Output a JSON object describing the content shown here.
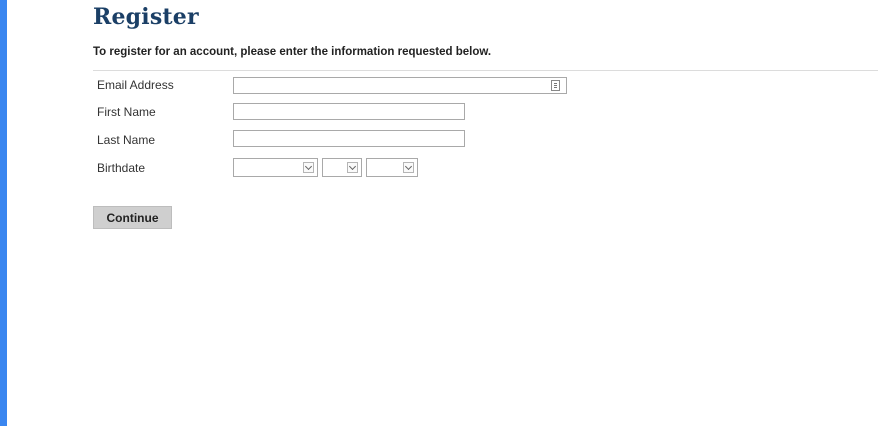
{
  "page": {
    "title": "Register",
    "intro": "To register for an account, please enter the information requested below."
  },
  "form": {
    "email_label": "Email Address",
    "email_value": "",
    "first_name_label": "First Name",
    "first_name_value": "",
    "last_name_label": "Last Name",
    "last_name_value": "",
    "birthdate_label": "Birthdate",
    "birth_month_value": "",
    "birth_day_value": "",
    "birth_year_value": ""
  },
  "actions": {
    "continue_label": "Continue"
  },
  "colors": {
    "accent_stripe": "#3a86f0",
    "title": "#1b3f66",
    "button_bg": "#cfcfcf"
  }
}
